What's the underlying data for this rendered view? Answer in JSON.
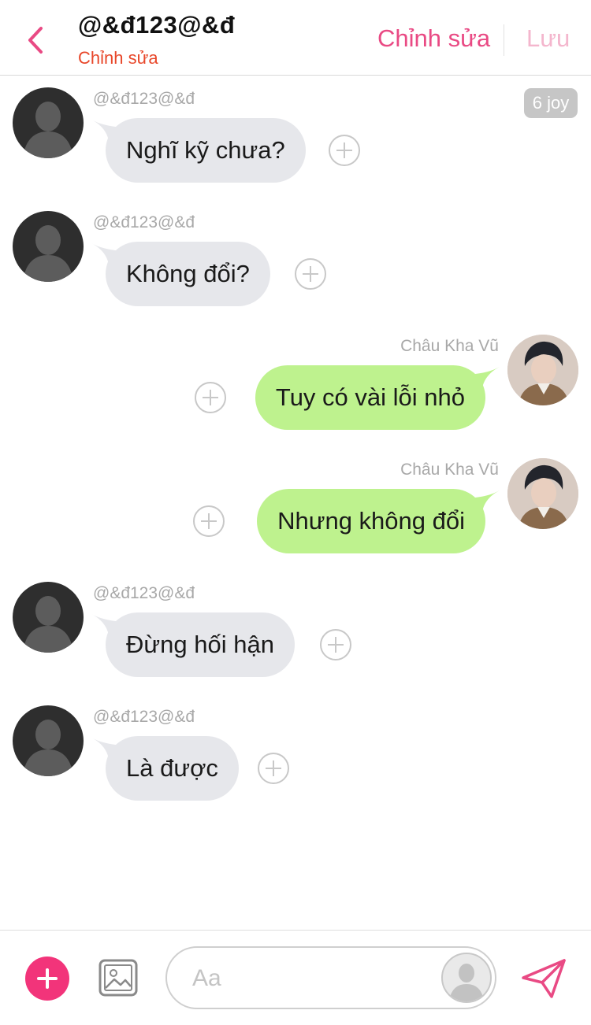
{
  "header": {
    "title": "@&đ123@&đ",
    "subtitle": "Chỉnh sửa",
    "edit_label": "Chỉnh sửa",
    "save_label": "Lưu"
  },
  "joy_badge": "6 joy",
  "messages": [
    {
      "sender": "@&đ123@&đ",
      "text": "Nghĩ kỹ chưa?",
      "direction": "incoming"
    },
    {
      "sender": "@&đ123@&đ",
      "text": "Không đổi?",
      "direction": "incoming"
    },
    {
      "sender": "Châu Kha Vũ",
      "text": "Tuy có vài lỗi nhỏ",
      "direction": "outgoing"
    },
    {
      "sender": "Châu Kha Vũ",
      "text": "Nhưng không đổi",
      "direction": "outgoing"
    },
    {
      "sender": "@&đ123@&đ",
      "text": "Đừng hối hận",
      "direction": "incoming"
    },
    {
      "sender": "@&đ123@&đ",
      "text": "Là được",
      "direction": "incoming"
    }
  ],
  "composer": {
    "placeholder": "Aa"
  },
  "colors": {
    "accent": "#e94a84",
    "subtitle": "#e8472a",
    "incoming_bubble": "#e6e7eb",
    "outgoing_bubble": "#bef28e",
    "add_button": "#f2347a"
  }
}
